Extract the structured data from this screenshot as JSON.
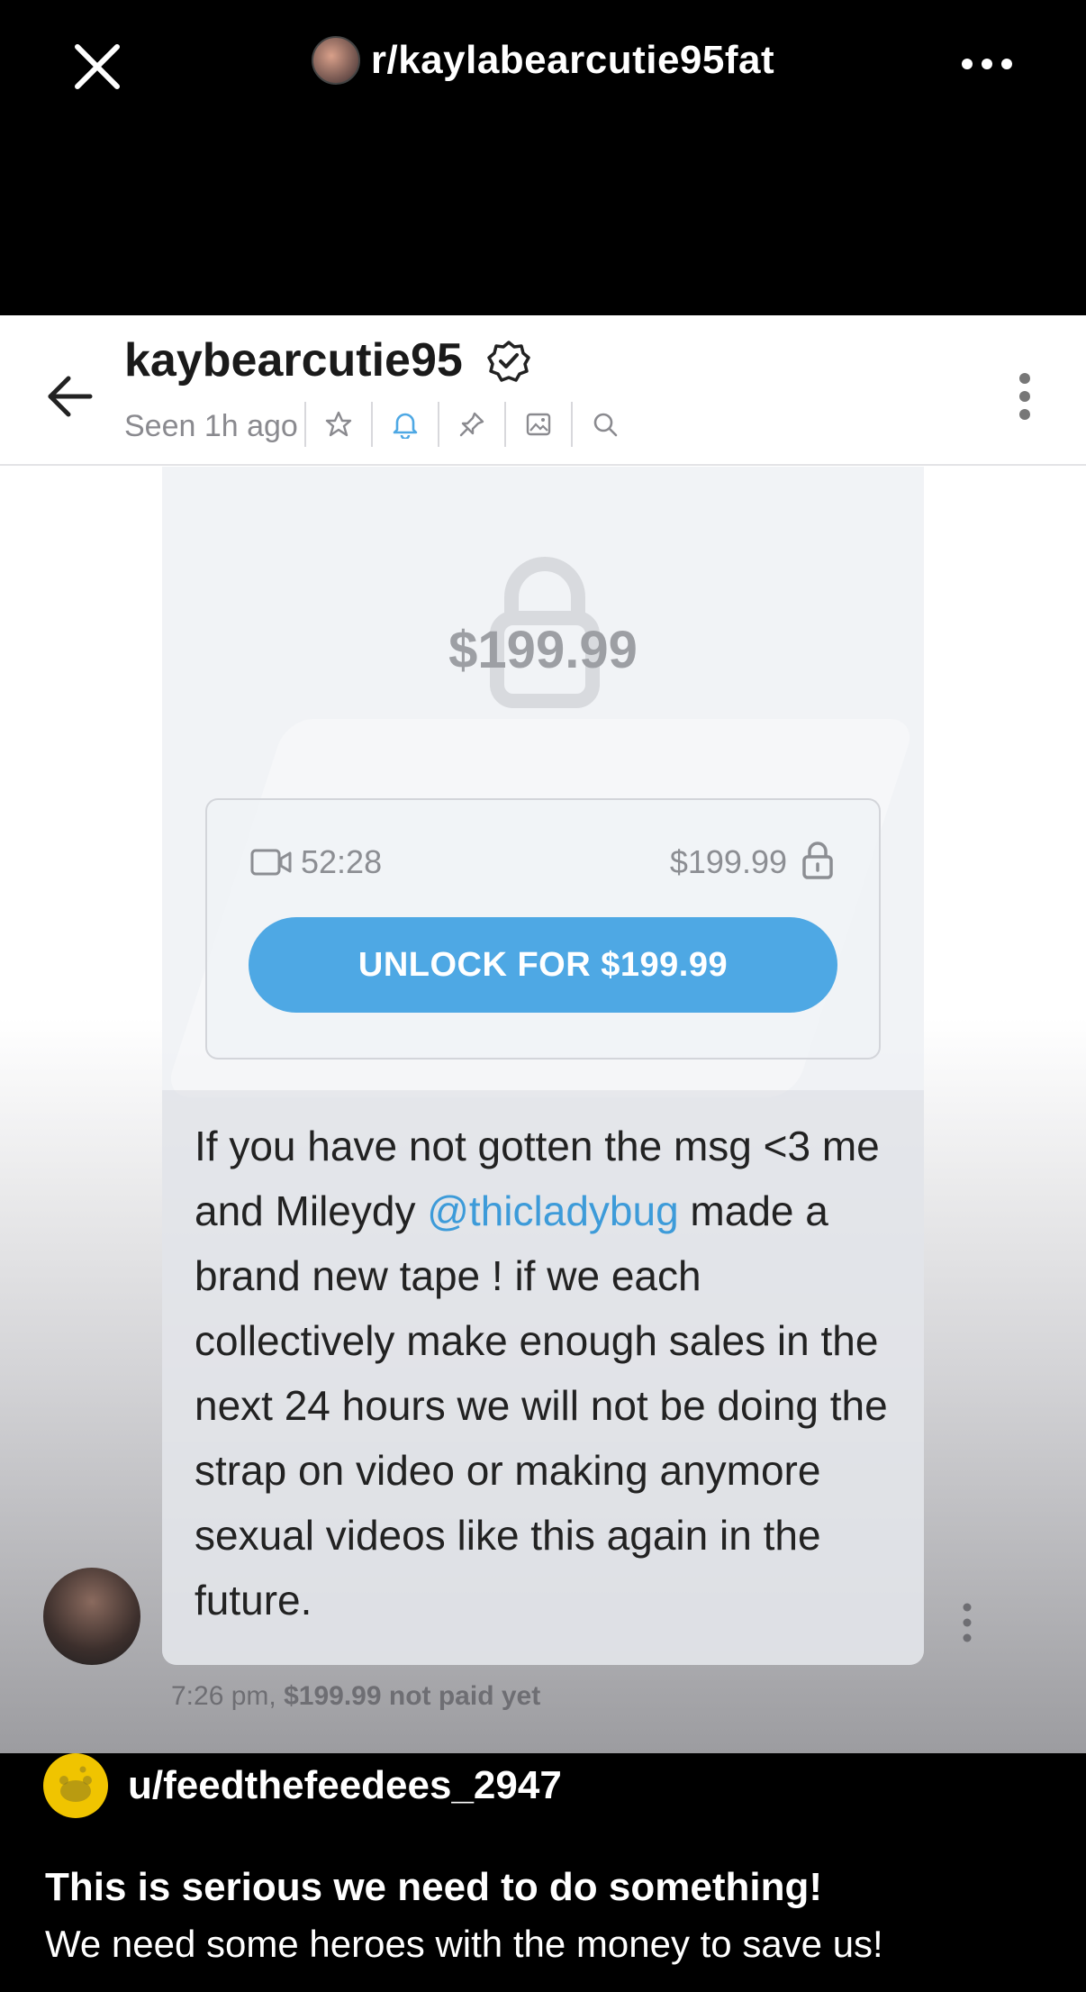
{
  "top_bar": {
    "subreddit": "r/kaylabearcutie95fat",
    "icons": [
      "close-icon",
      "more-icon"
    ]
  },
  "chat": {
    "name": "kaybearcutie95",
    "seen": "Seen 1h ago",
    "header_icons": [
      "star-icon",
      "bell-icon",
      "pin-icon",
      "image-icon",
      "search-icon"
    ],
    "locked_price": "$199.99",
    "duration": "52:28",
    "pay_price": "$199.99",
    "unlock_label": "UNLOCK FOR $199.99",
    "message": {
      "part1": "If you have not gotten the msg <3 me and Mileydy ",
      "mention": "@thicladybug",
      "part2": " made a brand new tape ! if we each collectively make enough sales in the next 24 hours we will not be doing the strap on video or making anymore sexual videos like this again in the future."
    },
    "time": "7:26 pm,",
    "meta_price": "$199.99",
    "meta_status": "not paid yet"
  },
  "post": {
    "username": "u/feedthefeedees_2947",
    "title": "This is serious we need to do something!",
    "body": "We need some heroes with the money to save us!"
  },
  "colors": {
    "accent_blue": "#4ea8e4",
    "mention_blue": "#3d9bd9",
    "user_avatar_yellow": "#f0c400"
  }
}
